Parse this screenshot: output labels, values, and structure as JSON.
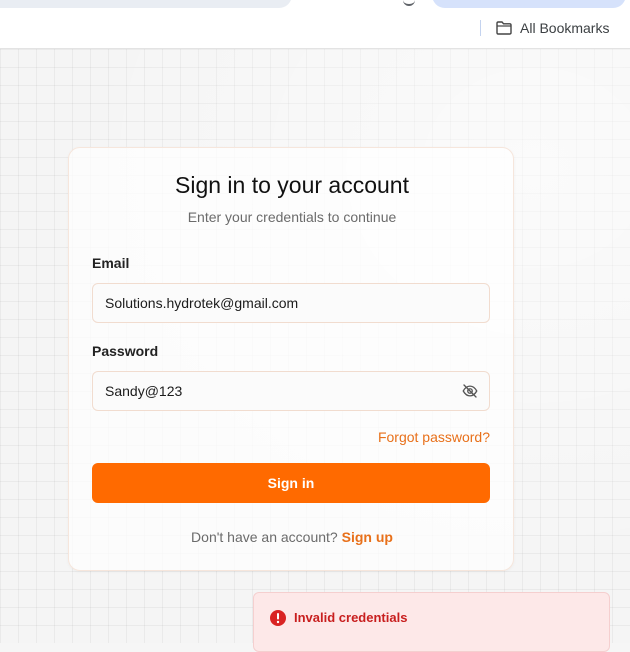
{
  "bookmarks_bar": {
    "all_bookmarks_label": "All Bookmarks"
  },
  "icons": {
    "folder": "folder-icon",
    "eye_off": "eye-off-icon",
    "alert": "alert-circle-icon"
  },
  "login": {
    "title": "Sign in to your account",
    "subtitle": "Enter your credentials to continue",
    "email_label": "Email",
    "email_value": "Solutions.hydrotek@gmail.com",
    "password_label": "Password",
    "password_value": "Sandy@123",
    "forgot_password": "Forgot password?",
    "sign_in_button": "Sign in",
    "signup_prompt": "Don't have an account?",
    "signup_link": "Sign up"
  },
  "toast": {
    "message": "Invalid credentials"
  },
  "colors": {
    "accent": "#ff6a00",
    "link": "#e8701a",
    "error_bg": "#fde8e8",
    "error_text": "#c81e1e"
  }
}
